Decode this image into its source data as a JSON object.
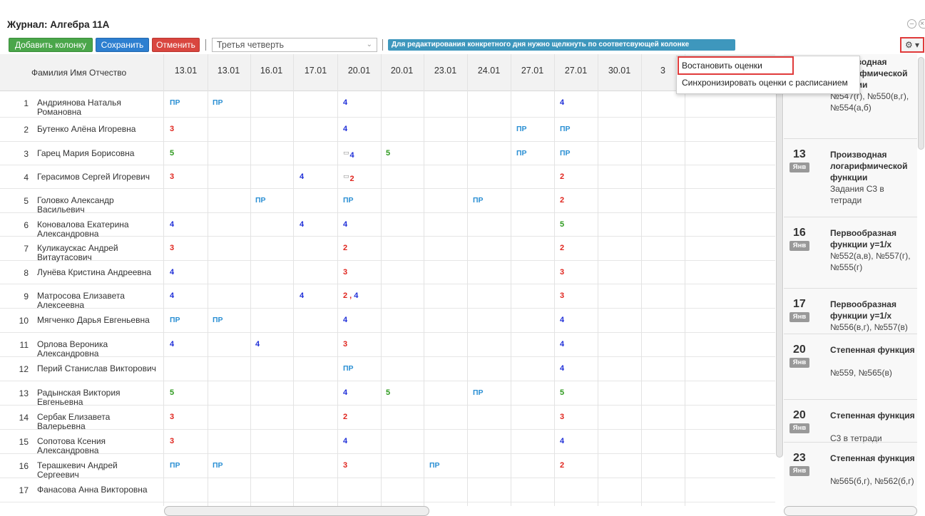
{
  "window": {
    "title": "Журнал: Алгебра 11А",
    "minimize": "–",
    "close": "×"
  },
  "toolbar": {
    "add_column": "Добавить колонку",
    "save": "Сохранить",
    "cancel": "Отменить",
    "period": "Третья четверть",
    "hint": "Для редактирования конкретного дня нужно щелкнуть по соответсвующей колонке",
    "settings_icon": "gear-icon"
  },
  "menu": {
    "items": [
      "Востановить оценки",
      "Синхронизировать оценки с расписанием"
    ]
  },
  "grid": {
    "name_header": "Фамилия Имя Отчество",
    "dates": [
      "13.01",
      "13.01",
      "16.01",
      "17.01",
      "20.01",
      "20.01",
      "23.01",
      "24.01",
      "27.01",
      "27.01",
      "30.01",
      "3"
    ],
    "students": [
      {
        "n": "1",
        "name": "Андриянова Наталья Романовна",
        "grades": [
          [
            "ПР",
            "p"
          ],
          [
            "ПР",
            "p"
          ],
          null,
          null,
          [
            "4",
            "4"
          ],
          null,
          null,
          null,
          null,
          [
            "4",
            "4"
          ],
          null,
          null
        ]
      },
      {
        "n": "2",
        "name": "Бутенко Алёна Игоревна",
        "grades": [
          [
            "3",
            "3"
          ],
          null,
          null,
          null,
          [
            "4",
            "4"
          ],
          null,
          null,
          null,
          [
            "ПР",
            "p"
          ],
          [
            "ПР",
            "p"
          ],
          null,
          null
        ]
      },
      {
        "n": "3",
        "name": "Гарец Мария Борисовна",
        "grades": [
          [
            "5",
            "5"
          ],
          null,
          null,
          null,
          [
            "4",
            "4c"
          ],
          [
            "5",
            "5"
          ],
          null,
          null,
          [
            "ПР",
            "p"
          ],
          [
            "ПР",
            "p"
          ],
          null,
          null
        ]
      },
      {
        "n": "4",
        "name": "Герасимов Сергей Игоревич",
        "grades": [
          [
            "3",
            "3"
          ],
          null,
          null,
          [
            "4",
            "4"
          ],
          [
            "2",
            "3c"
          ],
          null,
          null,
          null,
          null,
          [
            "2",
            "3"
          ],
          null,
          null
        ]
      },
      {
        "n": "5",
        "name": "Головко Александр Васильевич",
        "grades": [
          null,
          null,
          [
            "ПР",
            "p"
          ],
          null,
          [
            "ПР",
            "p"
          ],
          null,
          null,
          [
            "ПР",
            "p"
          ],
          null,
          [
            "2",
            "3"
          ],
          null,
          null
        ]
      },
      {
        "n": "6",
        "name": "Коновалова Екатерина Александровна",
        "grades": [
          [
            "4",
            "4"
          ],
          null,
          null,
          [
            "4",
            "4"
          ],
          [
            "4",
            "4"
          ],
          null,
          null,
          null,
          null,
          [
            "5",
            "5"
          ],
          null,
          null
        ]
      },
      {
        "n": "7",
        "name": "Куликаускас Андрей Витаутасович",
        "grades": [
          [
            "3",
            "3"
          ],
          null,
          null,
          null,
          [
            "2",
            "3"
          ],
          null,
          null,
          null,
          null,
          [
            "2",
            "3"
          ],
          null,
          null
        ]
      },
      {
        "n": "8",
        "name": "Лунёва Кристина Андреевна",
        "grades": [
          [
            "4",
            "4"
          ],
          null,
          null,
          null,
          [
            "3",
            "3"
          ],
          null,
          null,
          null,
          null,
          [
            "3",
            "3"
          ],
          null,
          null
        ]
      },
      {
        "n": "9",
        "name": "Матросова Елизавета Алексеевна",
        "grades": [
          [
            "4",
            "4"
          ],
          null,
          null,
          [
            "4",
            "4"
          ],
          [
            "2 , 4",
            "24"
          ],
          null,
          null,
          null,
          null,
          [
            "3",
            "3"
          ],
          null,
          null
        ]
      },
      {
        "n": "10",
        "name": "Мягченко Дарья Евгеньевна",
        "grades": [
          [
            "ПР",
            "p"
          ],
          [
            "ПР",
            "p"
          ],
          null,
          null,
          [
            "4",
            "4"
          ],
          null,
          null,
          null,
          null,
          [
            "4",
            "4"
          ],
          null,
          null
        ]
      },
      {
        "n": "11",
        "name": "Орлова Вероника Александровна",
        "grades": [
          [
            "4",
            "4"
          ],
          null,
          [
            "4",
            "4"
          ],
          null,
          [
            "3",
            "3"
          ],
          null,
          null,
          null,
          null,
          [
            "4",
            "4"
          ],
          null,
          null
        ]
      },
      {
        "n": "12",
        "name": "Перий Станислав Викторович",
        "grades": [
          null,
          null,
          null,
          null,
          [
            "ПР",
            "p"
          ],
          null,
          null,
          null,
          null,
          [
            "4",
            "4"
          ],
          null,
          null
        ]
      },
      {
        "n": "13",
        "name": "Радынская Виктория Евгеньевна",
        "grades": [
          [
            "5",
            "5"
          ],
          null,
          null,
          null,
          [
            "4",
            "4"
          ],
          [
            "5",
            "5"
          ],
          null,
          [
            "ПР",
            "p"
          ],
          null,
          [
            "5",
            "5"
          ],
          null,
          null
        ]
      },
      {
        "n": "14",
        "name": "Сербак Елизавета Валерьевна",
        "grades": [
          [
            "3",
            "3"
          ],
          null,
          null,
          null,
          [
            "2",
            "3"
          ],
          null,
          null,
          null,
          null,
          [
            "3",
            "3"
          ],
          null,
          null
        ]
      },
      {
        "n": "15",
        "name": "Сопотова Ксения Александровна",
        "grades": [
          [
            "3",
            "3"
          ],
          null,
          null,
          null,
          [
            "4",
            "4"
          ],
          null,
          null,
          null,
          null,
          [
            "4",
            "4"
          ],
          null,
          null
        ]
      },
      {
        "n": "16",
        "name": "Терашкевич Андрей Сергеевич",
        "grades": [
          [
            "ПР",
            "p"
          ],
          [
            "ПР",
            "p"
          ],
          null,
          null,
          [
            "3",
            "3"
          ],
          null,
          [
            "ПР",
            "p"
          ],
          null,
          null,
          [
            "2",
            "3"
          ],
          null,
          null
        ]
      },
      {
        "n": "17",
        "name": "Фанасова Анна Викторовна",
        "grades": [
          null,
          null,
          null,
          null,
          null,
          null,
          null,
          null,
          null,
          null,
          null,
          null
        ]
      }
    ]
  },
  "lessons": [
    {
      "day": "",
      "mon": "",
      "title": "Производная логарифмической функции",
      "task": "№547(г), №550(в,г), №554(а,б)"
    },
    {
      "day": "13",
      "mon": "Янв",
      "title": "Производная логарифмической функции",
      "task": "Задания С3 в тетради"
    },
    {
      "day": "16",
      "mon": "Янв",
      "title": "Первообразная функции y=1/x",
      "task": "№552(а,в), №557(г), №555(г)"
    },
    {
      "day": "17",
      "mon": "Янв",
      "title": "Первообразная функции y=1/x",
      "task": "№556(в,г), №557(в)"
    },
    {
      "day": "20",
      "mon": "Янв",
      "title": "Степенная функция",
      "task": "№559, №565(в)"
    },
    {
      "day": "20",
      "mon": "Янв",
      "title": "Степенная функция",
      "task": "С3 в тетради"
    },
    {
      "day": "23",
      "mon": "Янв",
      "title": "Степенная функция",
      "task": "№565(б,г), №562(б,г)"
    }
  ]
}
